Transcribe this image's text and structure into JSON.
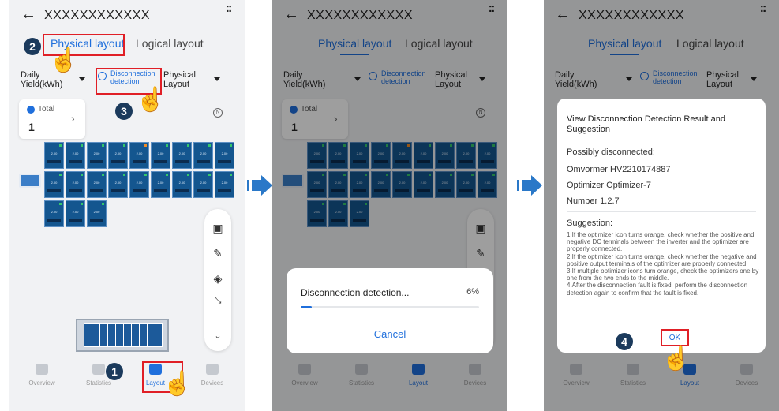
{
  "header": {
    "title": "XXXXXXXXXXXX",
    "back_icon": "←",
    "more_icon": "::"
  },
  "tabs": [
    {
      "label": "Physical layout",
      "active": true
    },
    {
      "label": "Logical layout",
      "active": false
    }
  ],
  "filters": {
    "yield": "Daily Yield(kWh)",
    "disconnection": "Disconnection detection",
    "physical": "Physical Layout"
  },
  "total": {
    "label": "Total",
    "value": "1"
  },
  "panel_value": "2.00",
  "toolbar_icons": [
    "image-icon",
    "pen-icon",
    "layers-icon",
    "shrink-icon",
    "chevron-down-icon"
  ],
  "nav": [
    {
      "label": "Overview",
      "active": false
    },
    {
      "label": "Statistics",
      "active": false
    },
    {
      "label": "Layout",
      "active": true
    },
    {
      "label": "Devices",
      "active": false
    }
  ],
  "progress_sheet": {
    "title": "Disconnection detection...",
    "percent_text": "6%",
    "percent": 6,
    "cancel": "Cancel"
  },
  "result_dialog": {
    "title": "View Disconnection Detection Result and Suggestion",
    "possibly": "Possibly disconnected:",
    "device": "Omvormer HV2210174887",
    "optimizer": "Optimizer Optimizer-7",
    "number": "Number 1.2.7",
    "suggestion_label": "Suggestion:",
    "suggestion_body": "1.If the optimizer icon turns orange, check whether the positive and negative DC terminals between the inverter and the optimizer are properly connected.\n2.If the optimizer icon turns orange, check whether the negative and positive output terminals of the optimizer are properly connected.\n3.If multiple optimizer icons turn orange, check the optimizers one by one from the two ends to the middle.\n4.After the disconnection fault is fixed, perform the disconnection detection again to confirm that the fault is fixed.",
    "ok": "OK"
  },
  "steps": [
    "1",
    "2",
    "3",
    "4"
  ],
  "colors": {
    "accent": "#1f6fdc",
    "highlight": "#e01f26",
    "panel": "#14568f",
    "arrow": "#2a78c8",
    "step_badge": "#1b3a5c"
  }
}
